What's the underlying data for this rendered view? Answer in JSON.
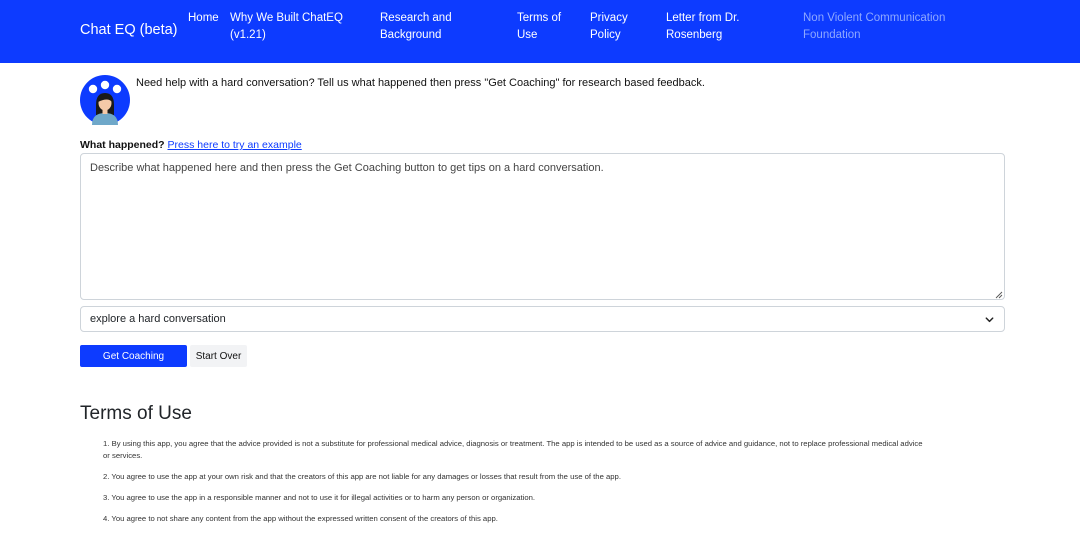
{
  "navbar": {
    "brand": "Chat EQ (beta)",
    "links": [
      {
        "line1": "Home",
        "line2": ""
      },
      {
        "line1": "Why We Built ChatEQ",
        "line2": "(v1.21)"
      },
      {
        "line1": "Research and",
        "line2": "Background"
      },
      {
        "line1": "Terms of",
        "line2": "Use"
      },
      {
        "line1": "Privacy",
        "line2": "Policy"
      },
      {
        "line1": "Letter from Dr.",
        "line2": "Rosenberg"
      },
      {
        "line1": "Non Violent Communication",
        "line2": "Foundation"
      }
    ]
  },
  "intro": {
    "text": "Need help with a hard conversation? Tell us what happened then press \"Get Coaching\" for research based feedback."
  },
  "form": {
    "question_label": "What happened?",
    "example_link": "Press here to try an example",
    "textarea_placeholder": "Describe what happened here and then press the Get Coaching button to get tips on a hard conversation.",
    "select_value": "explore a hard conversation",
    "primary_button": "Get Coaching",
    "secondary_button": "Start Over"
  },
  "terms": {
    "heading": "Terms of Use",
    "items": [
      {
        "num": "1.",
        "line1": "By using this app, you agree that the advice provided is not a substitute for professional medical advice, diagnosis or treatment. The app is intended to be used as a source of advice and guidance, not to replace professional medical advice",
        "line2": "or services."
      },
      {
        "num": "2.",
        "line1": "You agree to use the app at your own risk and that the creators of this app are not liable for any damages or losses that result from the use of the app.",
        "line2": ""
      },
      {
        "num": "3.",
        "line1": "You agree to use the app in a responsible manner and not to use it for illegal activities or to harm any person or organization.",
        "line2": ""
      },
      {
        "num": "4.",
        "line1": "You agree to not share any content from the app without the expressed written consent of the creators of this app.",
        "line2": ""
      }
    ]
  },
  "colors": {
    "brand_blue": "#0d3bff",
    "muted_link": "#8ea8ff"
  },
  "icons": {
    "avatar": "avatar-icon",
    "select": "chevron-down-icon",
    "grip": "resize-grip-icon"
  }
}
